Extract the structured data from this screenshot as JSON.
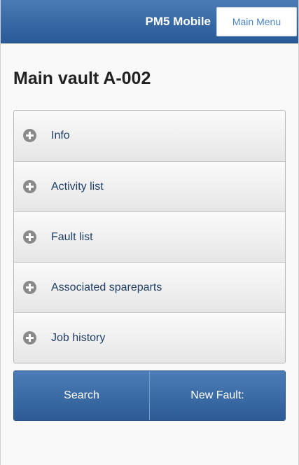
{
  "header": {
    "title": "PM5 Mobile",
    "main_menu_label": "Main Menu"
  },
  "page": {
    "title": "Main vault A-002"
  },
  "accordion": {
    "items": [
      {
        "label": "Info",
        "icon": "plus-circle-icon"
      },
      {
        "label": "Activity list",
        "icon": "plus-circle-icon"
      },
      {
        "label": "Fault list",
        "icon": "plus-circle-icon"
      },
      {
        "label": "Associated spareparts",
        "icon": "plus-circle-icon"
      },
      {
        "label": "Job history",
        "icon": "plus-circle-icon"
      }
    ]
  },
  "actions": {
    "search_label": "Search",
    "new_fault_label": "New Fault:"
  },
  "colors": {
    "header_blue": "#2a5a96",
    "link_blue": "#4a86c8",
    "label_blue": "#1f3e66"
  }
}
